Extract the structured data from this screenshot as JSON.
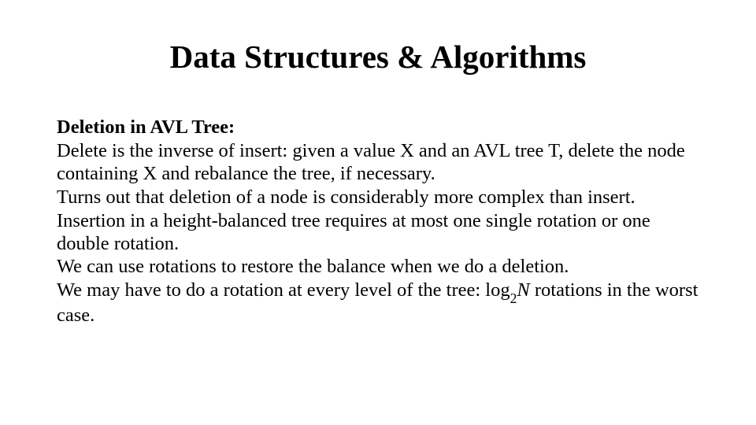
{
  "title": "Data Structures & Algorithms",
  "subheading": "Deletion in AVL Tree:",
  "p1": "Delete is the inverse of insert: given a value X and an AVL tree T, delete the node containing X and rebalance the tree, if necessary.",
  "p2": "Turns out that deletion of a node is considerably more complex than insert.",
  "p3": "Insertion in a height-balanced tree requires at most one single rotation or one double rotation.",
  "p4": "We can use rotations to restore the balance when we do a deletion.",
  "p5_prefix": "We may have to do a rotation at every level of the tree: log",
  "p5_sub": "2",
  "p5_italic": "N ",
  "p5_suffix": "rotations in the worst case."
}
